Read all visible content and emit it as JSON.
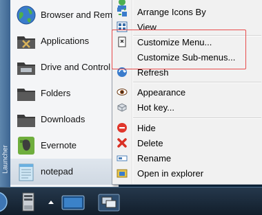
{
  "launcher": {
    "title": "Launcher",
    "items": [
      {
        "label": "Browser and Rem",
        "icon": "globe-icon"
      },
      {
        "label": "Applications",
        "icon": "applications-folder-icon"
      },
      {
        "label": "Drive and Control",
        "icon": "drive-folder-icon"
      },
      {
        "label": "Folders",
        "icon": "folder-icon"
      },
      {
        "label": "Downloads",
        "icon": "downloads-folder-icon"
      },
      {
        "label": "Evernote",
        "icon": "evernote-icon"
      },
      {
        "label": "notepad",
        "icon": "notepad-icon"
      }
    ]
  },
  "context_menu": {
    "items": [
      {
        "label": "Arrange Icons By",
        "icon": "arrange-icon"
      },
      {
        "label": "View",
        "icon": "view-icon"
      },
      {
        "label": "Customize Menu...",
        "icon": "customize-icon"
      },
      {
        "label": "Customize Sub-menus...",
        "icon": ""
      },
      {
        "label": "Refresh",
        "icon": "refresh-icon"
      },
      {
        "label": "Appearance",
        "icon": "eye-icon"
      },
      {
        "label": "Hot key...",
        "icon": "hotkey-icon"
      },
      {
        "label": "Hide",
        "icon": "hide-icon"
      },
      {
        "label": "Delete",
        "icon": "delete-icon"
      },
      {
        "label": "Rename",
        "icon": "rename-icon"
      },
      {
        "label": "Open in explorer",
        "icon": "explorer-icon"
      }
    ],
    "highlight_color": "#e84b4b"
  },
  "taskbar": {
    "items": [
      "start-orb-icon",
      "server-icon",
      "chevron-up-icon",
      "monitor-icon",
      "windows-icon"
    ]
  }
}
